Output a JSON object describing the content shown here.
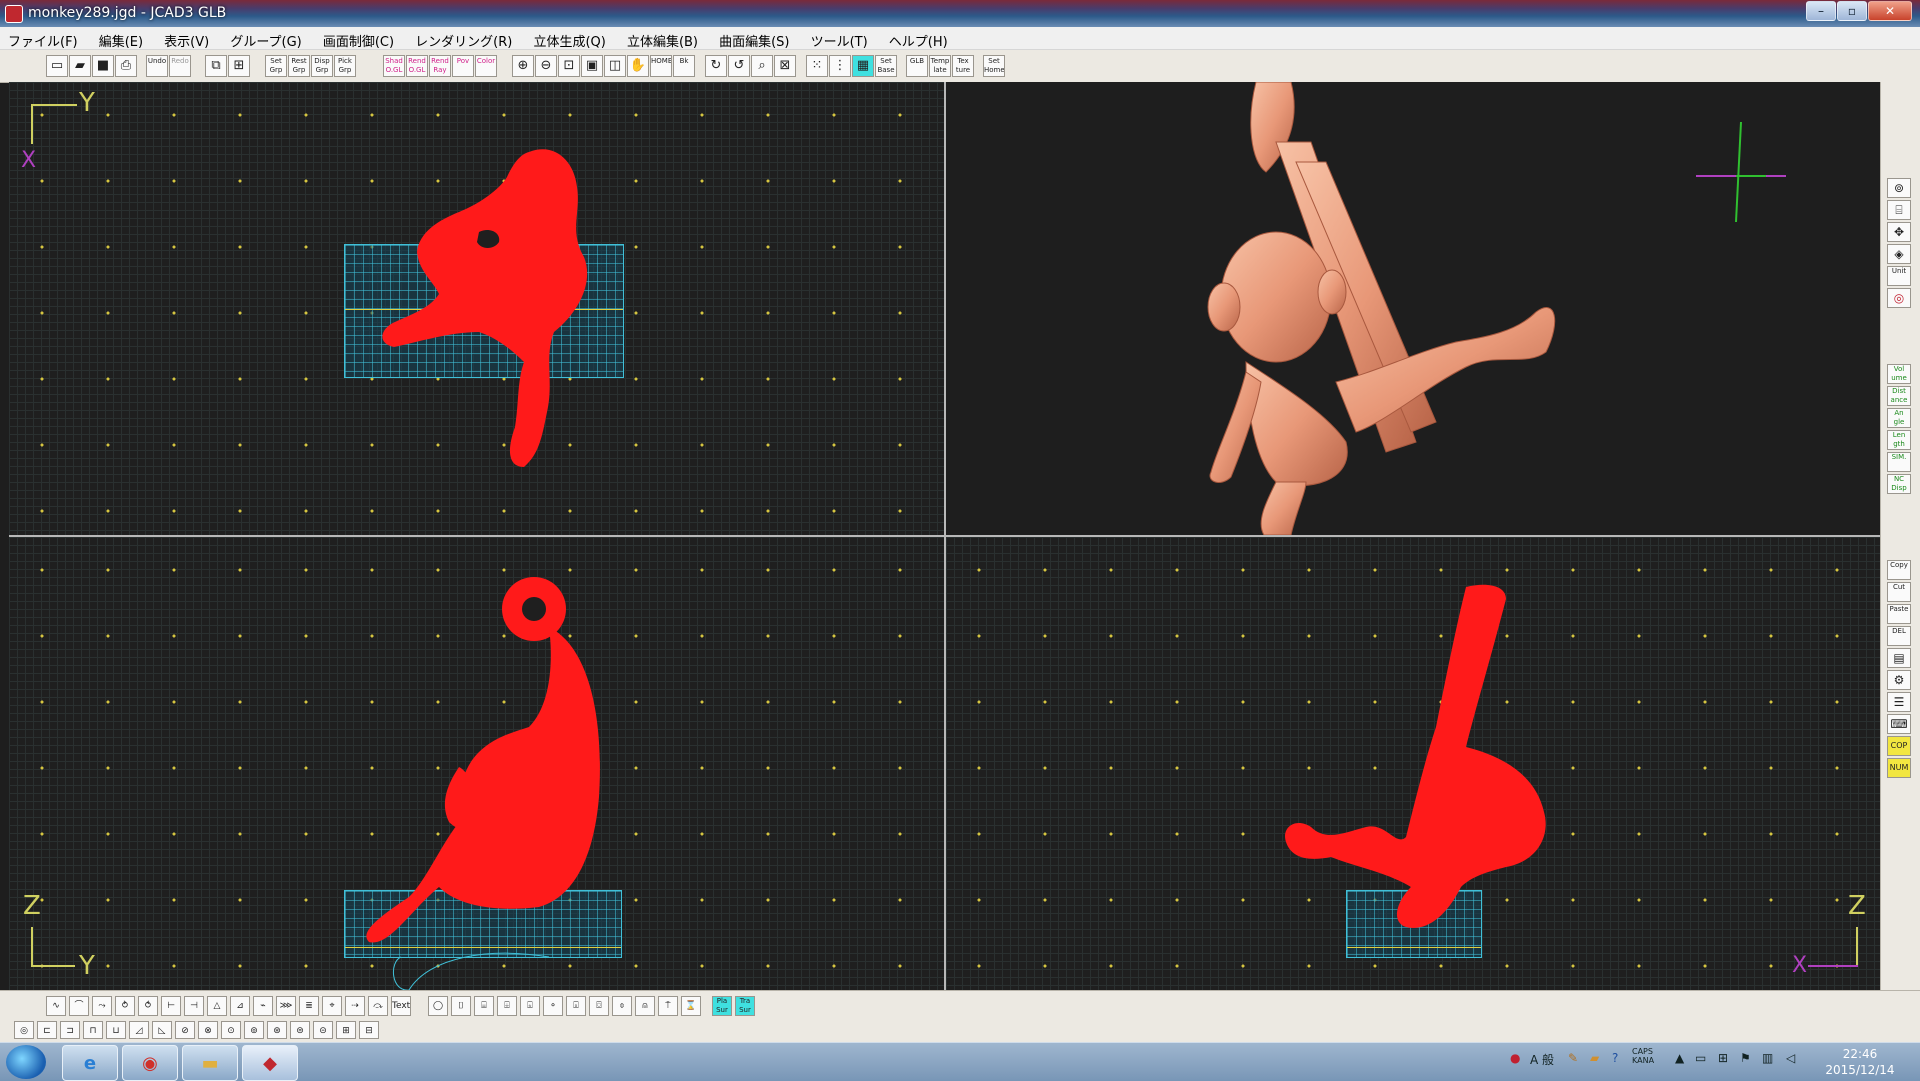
{
  "window": {
    "title": "monkey289.jgd - JCAD3 GLB",
    "minimize": "–",
    "maximize": "▫",
    "close": "✕"
  },
  "menu": [
    "ファイル(F)",
    "編集(E)",
    "表示(V)",
    "グループ(G)",
    "画面制御(C)",
    "レンダリング(R)",
    "立体生成(Q)",
    "立体編集(B)",
    "曲面編集(S)",
    "ツール(T)",
    "ヘルプ(H)"
  ],
  "toolbar": {
    "undo": "Undo",
    "redo": "Redo",
    "set_grp": "Set Grp",
    "rest_grp": "Rest Grp",
    "disp_grp": "Disp Grp",
    "pick_grp": "Pick Grp",
    "shad_ogl": "Shad O.GL",
    "rend_ogl": "Rend O.GL",
    "rend_ray": "Rend Ray",
    "pov": "Pov",
    "color": "Color",
    "home": "HOME",
    "bk": "Bk",
    "set_base": "Set Base",
    "glb": "GLB",
    "template": "Temp late",
    "texture": "Tex ture",
    "set_home": "Set Home"
  },
  "viewports": {
    "top_left": {
      "axis_h": "Y",
      "axis_v": "X"
    },
    "bottom_left": {
      "axis_v": "Z",
      "axis_h": "Y"
    },
    "bottom_right": {
      "axis_v": "Z",
      "axis_h": "X"
    }
  },
  "right_toolbar": {
    "unit": "Unit",
    "volume": "Vol ume",
    "distance": "Dist ance",
    "angle": "An gle",
    "length": "Len gth",
    "sim": "SIM.",
    "nc_disp": "NC Disp",
    "copy": "Copy",
    "cut": "Cut",
    "paste": "Paste",
    "del": "DEL",
    "cop": "COP",
    "num": "NUM"
  },
  "bottom_toolbar": {
    "text": "Text",
    "btn_a": "Pla Sur",
    "btn_b": "Tra Sur"
  },
  "taskbar": {
    "ime": "A 般",
    "caps": "CAPS",
    "kana": "KANA",
    "time": "22:46",
    "date": "2015/12/14"
  },
  "colors": {
    "model_wire": "#ff1a1a",
    "bbox": "#40c0d8",
    "grid_dot": "#d6c640",
    "render": "#e89878"
  }
}
